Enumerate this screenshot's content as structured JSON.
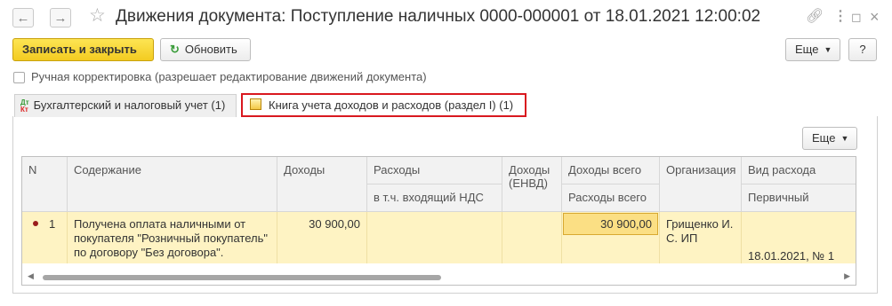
{
  "window": {
    "title": "Движения документа: Поступление наличных 0000-000001 от 18.01.2021 12:00:02",
    "back_icon": "arrow-left-icon",
    "forward_icon": "arrow-right-icon",
    "favorite_icon": "star-icon",
    "link_icon": "link-icon",
    "menu_icon": "more-vertical-icon",
    "restore_icon": "restore-icon",
    "close_icon": "close-icon"
  },
  "toolbar": {
    "save_close_label": "Записать и закрыть",
    "refresh_label": "Обновить",
    "more_label": "Еще",
    "help_label": "?"
  },
  "manual_correction": {
    "checked": false,
    "label": "Ручная корректировка (разрешает редактирование движений документа)"
  },
  "tabs": [
    {
      "label": "Бухгалтерский и налоговый учет (1)",
      "icon": "dt-kt-icon",
      "active": false
    },
    {
      "label": "Книга учета доходов и расходов (раздел I) (1)",
      "icon": "book-icon",
      "active": true
    }
  ],
  "icon_text": {
    "dt": "Дт",
    "kt": "Кт"
  },
  "table_toolbar": {
    "more_label": "Еще"
  },
  "table": {
    "headers": {
      "n": "N",
      "content": "Содержание",
      "income": "Доходы",
      "expenses": "Расходы",
      "vat": "в т.ч. входящий НДС",
      "income_envd": "Доходы (ЕНВД)",
      "income_total": "Доходы всего",
      "expenses_total": "Расходы всего",
      "org": "Организация",
      "expense_type": "Вид расхода",
      "primary": "Первичный"
    },
    "rows": [
      {
        "n": "1",
        "content": "Получена оплата наличными от покупателя \"Розничный покупатель\" по договору \"Без договора\".",
        "income": "30 900,00",
        "expenses": "",
        "vat": "",
        "income_envd": "",
        "income_total": "30 900,00",
        "expenses_total": "",
        "org": "Грищенко И. С. ИП",
        "expense_type": "",
        "primary": "18.01.2021, № 1"
      }
    ]
  },
  "colors": {
    "accent_yellow": "#f3cb21",
    "tab_highlight": "#d9181f",
    "row_bg": "#fef3c3",
    "selected_cell": "#fbdf84"
  }
}
